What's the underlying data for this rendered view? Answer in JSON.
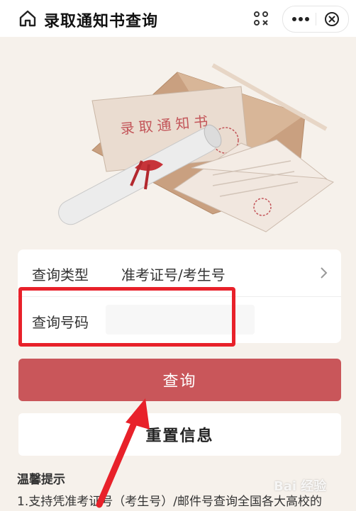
{
  "header": {
    "title": "录取通知书查询",
    "icons": {
      "home": "home-icon",
      "scan": "scan-icon",
      "more": "more-icon",
      "close": "close-icon"
    }
  },
  "hero": {
    "envelope_text": "录取通知书",
    "icon": "admission-letter-illustration"
  },
  "form": {
    "type_label": "查询类型",
    "type_value": "准考证号/考生号",
    "number_label": "查询号码",
    "number_value": "",
    "number_placeholder": ""
  },
  "buttons": {
    "query_label": "查询",
    "reset_label": "重置信息"
  },
  "tips": {
    "title": "温馨提示",
    "line1": "1.支持凭准考证号（考生号）/邮件号查询全国各大高校的"
  },
  "watermark": "Bai 经验",
  "colors": {
    "primary": "#c9565a",
    "highlight": "#e8212a",
    "background": "#f6f1eb"
  }
}
